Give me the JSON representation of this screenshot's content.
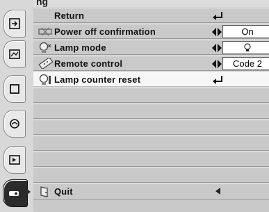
{
  "menu": {
    "heading": "ng",
    "return_label": "Return",
    "quit_label": "Quit",
    "items": [
      {
        "label": "Power off confirmation",
        "value": "On"
      },
      {
        "label": "Lamp mode",
        "value": "💡"
      },
      {
        "label": "Remote control",
        "value": "Code 2"
      },
      {
        "label": "Lamp counter reset"
      }
    ]
  },
  "tabs": [
    "menu-tab-input",
    "menu-tab-image",
    "menu-tab-screen",
    "menu-tab-image-adjust",
    "menu-tab-setting",
    "menu-tab-extra"
  ]
}
